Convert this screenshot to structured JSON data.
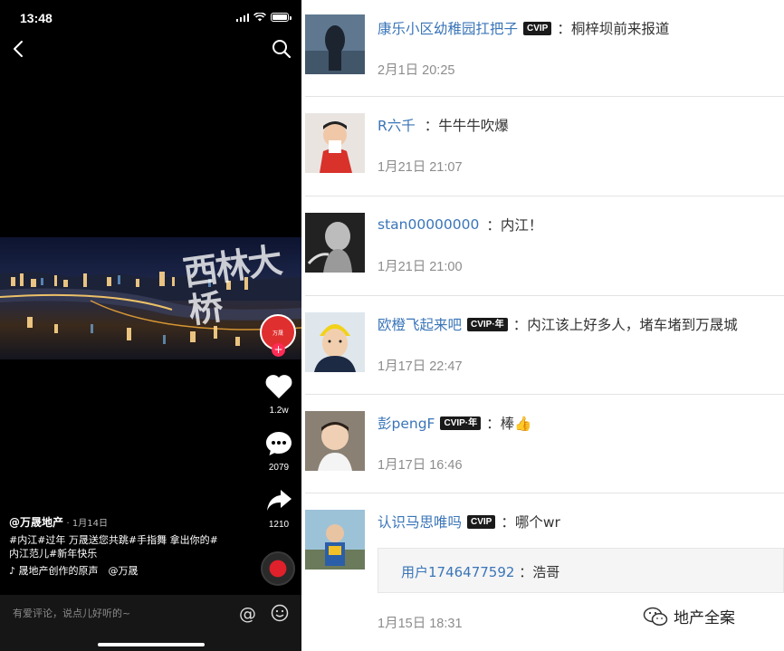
{
  "phone": {
    "status_time": "13:48",
    "video_title_art": "西林大桥",
    "brand_badge": "万晟",
    "actions": {
      "like_count": "1.2w",
      "comment_count": "2079",
      "share_count": "1210"
    },
    "caption": {
      "author": "@万晟地产",
      "date": "· 1月14日",
      "text_line1": "#内江#过年 万晟送您共跳#手指舞 拿出你的#",
      "text_line2": "内江范儿#新年快乐",
      "music": "♪ 晟地产创作的原声　@万晟"
    },
    "comment_placeholder": "有爱评论，说点儿好听的~",
    "at_symbol": "@"
  },
  "comments": [
    {
      "user": "康乐小区幼稚园扛把子",
      "vip": "CVIP",
      "text": "：桐梓坝前来报道",
      "time": "2月1日 20:25"
    },
    {
      "user": "R六千",
      "vip": "",
      "text": "：牛牛牛吹爆",
      "time": "1月21日 21:07"
    },
    {
      "user": "stan00000000",
      "vip": "",
      "text": "：内江！",
      "time": "1月21日 21:00"
    },
    {
      "user": "欧橙飞起来吧",
      "vip": "CVIP·年",
      "text": "：内江该上好多人，堵车堵到万晟城",
      "time": "1月17日 22:47"
    },
    {
      "user": "彭pengF",
      "vip": "CVIP·年",
      "text": "：棒👍",
      "time": "1月17日 16:46"
    },
    {
      "user": "认识马思唯吗",
      "vip": "CVIP",
      "text": "：哪个wr",
      "time": "1月15日 18:31"
    }
  ],
  "reply": {
    "user": "用户1746477592",
    "text": "：浩哥"
  },
  "watermark": "地产全案",
  "colors": {
    "username": "#3a75b8",
    "time": "#8c8c8c",
    "phone_bg": "#000000",
    "accent_red": "#fe2c55"
  }
}
